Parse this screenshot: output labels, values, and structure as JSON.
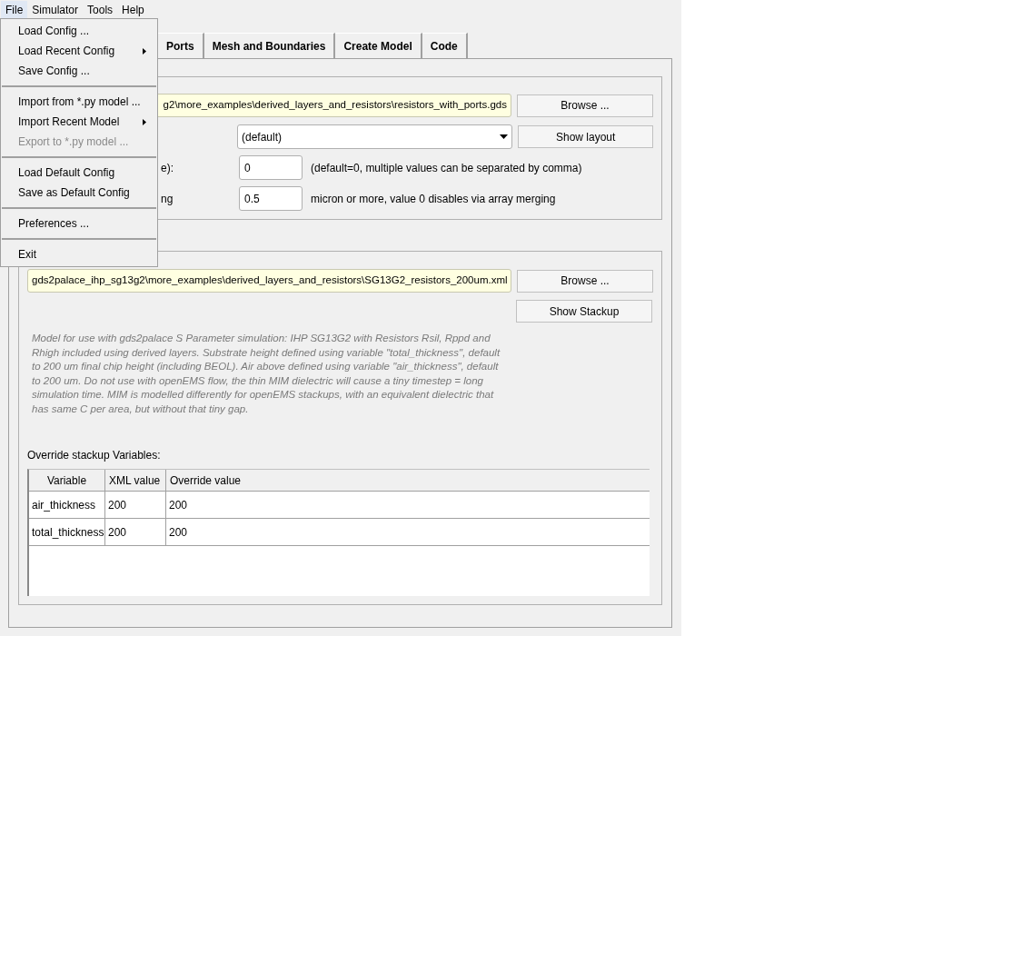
{
  "menu_bar": [
    {
      "label": "File",
      "open": true
    },
    {
      "label": "Simulator",
      "open": false
    },
    {
      "label": "Tools",
      "open": false
    },
    {
      "label": "Help",
      "open": false
    }
  ],
  "file_menu": [
    {
      "kind": "item",
      "label": "Load Config ...",
      "disabled": false,
      "submenu": false
    },
    {
      "kind": "item",
      "label": "Load Recent Config",
      "disabled": false,
      "submenu": true
    },
    {
      "kind": "item",
      "label": "Save Config ...",
      "disabled": false,
      "submenu": false
    },
    {
      "kind": "separator"
    },
    {
      "kind": "item",
      "label": "Import from *.py model ...",
      "disabled": false,
      "submenu": false
    },
    {
      "kind": "item",
      "label": "Import Recent Model",
      "disabled": false,
      "submenu": true
    },
    {
      "kind": "item",
      "label": "Export to *.py model ...",
      "disabled": true,
      "submenu": false
    },
    {
      "kind": "separator"
    },
    {
      "kind": "item",
      "label": "Load Default Config",
      "disabled": false,
      "submenu": false
    },
    {
      "kind": "item",
      "label": "Save as Default Config",
      "disabled": false,
      "submenu": false
    },
    {
      "kind": "separator"
    },
    {
      "kind": "item",
      "label": "Preferences ...",
      "disabled": false,
      "submenu": false
    },
    {
      "kind": "separator"
    },
    {
      "kind": "item",
      "label": "Exit",
      "disabled": false,
      "submenu": false
    }
  ],
  "tabs": [
    {
      "label": "Ports",
      "selected": false
    },
    {
      "label": "Mesh and Boundaries",
      "selected": false
    },
    {
      "label": "Create Model",
      "selected": false
    },
    {
      "label": "Code",
      "selected": false
    }
  ],
  "layout_group": {
    "file_path": "g2\\more_examples\\derived_layers_and_resistors\\resistors_with_ports.gds",
    "browse": "Browse ...",
    "cell_select": "(default)",
    "show_layout": "Show layout",
    "rows": [
      {
        "label": "e):",
        "value": "0",
        "hint": "(default=0, multiple values can be separated by comma)"
      },
      {
        "label": "ng",
        "value": "0.5",
        "hint": "micron or more, value 0 disables via array merging"
      }
    ]
  },
  "stackup_group": {
    "file_path": "gds2palace_ihp_sg13g2\\more_examples\\derived_layers_and_resistors\\SG13G2_resistors_200um.xml",
    "browse": "Browse ...",
    "show_stackup": "Show Stackup",
    "description": "Model for use with gds2palace S Parameter simulation: IHP SG13G2 with Resistors Rsil, Rppd and Rhigh included using derived layers. Substrate height defined using variable \"total_thickness\", default to 200 um final chip height (including BEOL). Air above defined using variable \"air_thickness\", default to 200 um. Do not use with openEMS flow, the thin MIM dielectric will cause a tiny timestep = long simulation time. MIM is modelled differently for openEMS stackups, with an equivalent dielectric that has same C per area, but without that tiny gap.",
    "override_label": "Override stackup Variables:",
    "table": {
      "columns": [
        "Variable",
        "XML value",
        "Override value"
      ],
      "rows": [
        [
          "air_thickness",
          "200",
          "200"
        ],
        [
          "total_thickness",
          "200",
          "200"
        ]
      ]
    }
  }
}
